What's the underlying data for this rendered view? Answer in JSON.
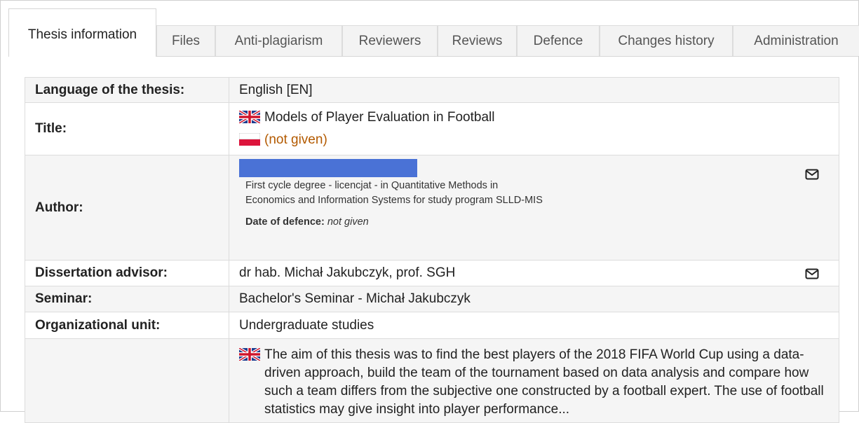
{
  "tabs": [
    {
      "label": "Thesis information",
      "active": true
    },
    {
      "label": "Files"
    },
    {
      "label": "Anti-plagiarism"
    },
    {
      "label": "Reviewers"
    },
    {
      "label": "Reviews"
    },
    {
      "label": "Defence"
    },
    {
      "label": "Changes history"
    },
    {
      "label": "Administration"
    }
  ],
  "rows": {
    "language": {
      "label": "Language of the thesis:",
      "value": "English [EN]"
    },
    "title": {
      "label": "Title:",
      "en_title": "Models of Player Evaluation in Football",
      "pl_title": "(not given)"
    },
    "author": {
      "label": "Author:",
      "program": "First cycle degree - licencjat - in Quantitative Methods in Economics and Information Systems for study program SLLD-MIS",
      "defence_label": "Date of defence:",
      "defence_value": "not given"
    },
    "advisor": {
      "label": "Dissertation advisor:",
      "value": "dr hab. Michał Jakubczyk, prof. SGH"
    },
    "seminar": {
      "label": "Seminar:",
      "value": "Bachelor's Seminar - Michał Jakubczyk"
    },
    "unit": {
      "label": "Organizational unit:",
      "value": "Undergraduate studies"
    },
    "abstract": {
      "text": "The aim of this thesis was to find the best players of the 2018 FIFA World Cup using a data-driven approach, build the team of the tournament based on data analysis and compare how such a team differs from the subjective one constructed by a football expert. The use of football statistics may give insight into player performance..."
    }
  },
  "icons": {
    "uk_flag": "uk-flag-icon",
    "pl_flag": "pl-flag-icon",
    "mail": "mail-icon"
  }
}
